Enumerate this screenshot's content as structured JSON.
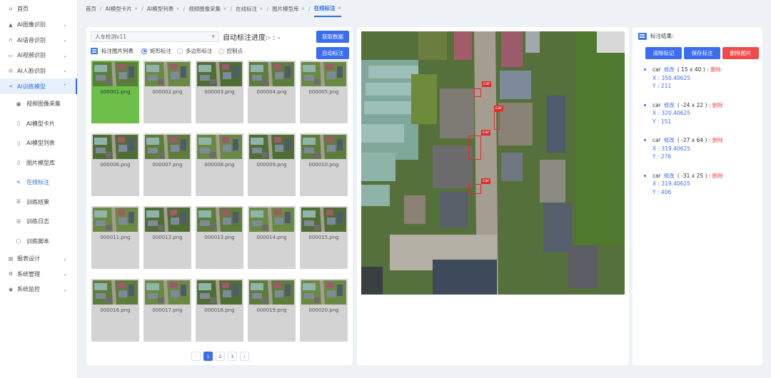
{
  "sidebar": {
    "home": "首页",
    "items": [
      {
        "label": "AI图像识别",
        "icon": "triangle-icon"
      },
      {
        "label": "AI语音识别",
        "icon": "headphone-icon"
      },
      {
        "label": "AI视频识别",
        "icon": "video-icon"
      },
      {
        "label": "AI人脸识别",
        "icon": "face-icon"
      },
      {
        "label": "AI训练模型",
        "icon": "share-icon"
      }
    ],
    "sub_items": [
      {
        "label": "视频图像采集",
        "icon": "image-icon"
      },
      {
        "label": "AI模型卡片",
        "icon": "doc-icon"
      },
      {
        "label": "AI模型列表",
        "icon": "doc-icon"
      },
      {
        "label": "图片模型库",
        "icon": "doc-icon"
      },
      {
        "label": "在线标注",
        "icon": "edit-icon"
      },
      {
        "label": "训练结果",
        "icon": "list-icon"
      },
      {
        "label": "训练日志",
        "icon": "list-icon"
      },
      {
        "label": "训练脚本",
        "icon": "file-icon"
      }
    ],
    "bottom_items": [
      {
        "label": "报表设计",
        "icon": "chart-icon"
      },
      {
        "label": "系统管理",
        "icon": "gear-icon"
      },
      {
        "label": "系统监控",
        "icon": "monitor-icon"
      }
    ]
  },
  "breadcrumbs": {
    "home": "首页",
    "tabs": [
      "AI模型卡片",
      "AI模型列表",
      "视频图像采集",
      "在线标注",
      "图片模型库"
    ],
    "current": "在线标注"
  },
  "left": {
    "model_select": "人车检测v11",
    "progress_label": "自动标注进度:- : -",
    "fetch_button": "获取数据",
    "auto_button": "自动标注",
    "list_title": "标注图片列表",
    "radios": [
      "矩形标注",
      "多边形标注",
      "控制点"
    ],
    "selected_radio": "矩形标注",
    "images": [
      "000001.png",
      "000002.png",
      "000003.png",
      "000004.png",
      "000005.png",
      "000006.png",
      "000007.png",
      "000008.png",
      "000009.png",
      "000010.png",
      "000011.png",
      "000012.png",
      "000013.png",
      "000014.png",
      "000015.png",
      "000016.png",
      "000017.png",
      "000018.png",
      "000019.png",
      "000020.png"
    ],
    "selected_image": "000001.png",
    "pages": [
      "1",
      "2",
      "3"
    ],
    "current_page": "1"
  },
  "annotation": {
    "label": "car"
  },
  "right": {
    "title": "标注结果:",
    "clear_button": "清除标记",
    "save_button": "保存标注",
    "delete_image_button": "删除图片",
    "results": [
      {
        "label": "car",
        "edit": "修改",
        "size": "( 15 x 40 ) :",
        "delete": "删除",
        "x": "X : 350.40625",
        "y": "Y : 211"
      },
      {
        "label": "car",
        "edit": "修改",
        "size": "( -24 x 22 ) :",
        "delete": "删除",
        "x": "X : 320.40625",
        "y": "Y : 151"
      },
      {
        "label": "car",
        "edit": "修改",
        "size": "( -27 x 64 ) :",
        "delete": "删除",
        "x": "X : 319.40625",
        "y": "Y : 276"
      },
      {
        "label": "car",
        "edit": "修改",
        "size": "( -31 x 25 ) :",
        "delete": "删除",
        "x": "X : 319.40625",
        "y": "Y : 406"
      }
    ]
  }
}
